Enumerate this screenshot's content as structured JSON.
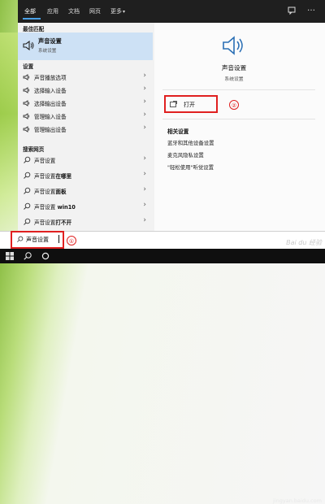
{
  "tabs": [
    {
      "label": "全部",
      "active": true
    },
    {
      "label": "应用"
    },
    {
      "label": "文档"
    },
    {
      "label": "网页"
    },
    {
      "label": "更多"
    }
  ],
  "left": {
    "best_title": "最佳匹配",
    "best": {
      "name": "声音设置",
      "sub": "系统设置"
    },
    "settings_title": "设置",
    "settings": [
      "声音播放选项",
      "选择输入设备",
      "选择输出设备",
      "管理输入设备",
      "管理输出设备"
    ],
    "web_title": "搜索网页",
    "web": [
      {
        "prefix": "声音设置",
        "bold": ""
      },
      {
        "prefix": "声音设置",
        "bold": "在哪里"
      },
      {
        "prefix": "声音设置",
        "bold": "面板"
      },
      {
        "prefix": "声音设置",
        "bold": " win10"
      },
      {
        "prefix": "声音设置",
        "bold": "打不开"
      }
    ]
  },
  "right": {
    "title": "声音设置",
    "subtitle": "系统设置",
    "open_label": "打开",
    "related_title": "相关设置",
    "related": [
      "蓝牙和其他设备设置",
      "麦克风隐私设置",
      "\"轻松使用\"听觉设置"
    ]
  },
  "annotations": {
    "one": "①",
    "two": "②"
  },
  "search": {
    "value": "声音设置"
  },
  "watermark": "Bai du 经验",
  "watermark_url": "jingyan.baidu.com",
  "colors": {
    "highlight": "#cde1f5",
    "accent": "#4aa0e6",
    "annotation": "#e02020",
    "taskbar": "#0f0f0f"
  }
}
